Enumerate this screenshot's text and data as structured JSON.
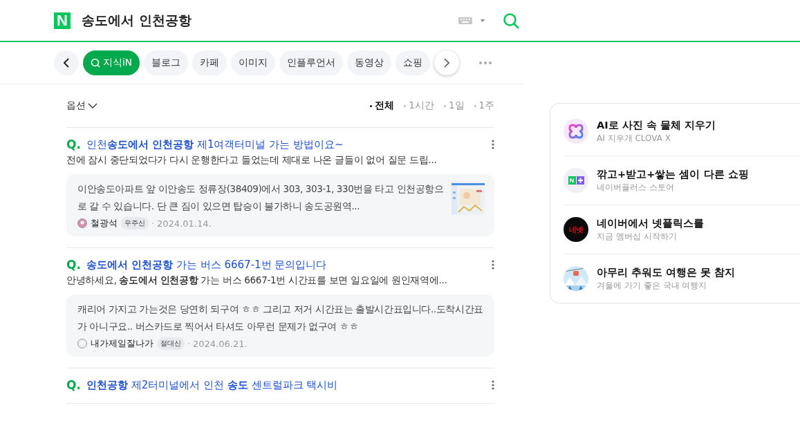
{
  "header": {
    "logo": "N",
    "query": "송도에서 인천공항"
  },
  "tabs": [
    {
      "label": "지식iN",
      "selected": true
    },
    {
      "label": "블로그",
      "selected": false
    },
    {
      "label": "카페",
      "selected": false
    },
    {
      "label": "이미지",
      "selected": false
    },
    {
      "label": "인플루언서",
      "selected": false
    },
    {
      "label": "동영상",
      "selected": false
    },
    {
      "label": "쇼핑",
      "selected": false
    }
  ],
  "options": {
    "label": "옵션",
    "periods": [
      {
        "label": "전체",
        "selected": true
      },
      {
        "label": "1시간",
        "selected": false
      },
      {
        "label": "1일",
        "selected": false
      },
      {
        "label": "1주",
        "selected": false
      }
    ]
  },
  "results": [
    {
      "mark": "Q.",
      "title": "인천**송도에서 인천공항** 제1여객터미널 가는 방법이요~",
      "snippet": "전에 잠시 중단되었다가 다시 운행한다고 들었는데 제대로 나온 글들이 없어 질문 드립...",
      "answer": {
        "text": "이안송도아파트 앞 이안송도 정류장(38409)에서 303, 303-1, 330번을 타고 인천공항으로 갈 수 있습니다. 단 큰 짐이 있으면 탑승이 불가하니 송도공원역...",
        "author": "철광석",
        "badge": "우주신",
        "date": "2024.01.14.",
        "thumbnail": true
      }
    },
    {
      "mark": "Q.",
      "title": "**송도에서 인천공항** 가는 버스 6667-1번 문의입니다",
      "snippet": "안녕하세요, **송도에서 인천공항** 가는 버스 6667-1번 시간표를 보면 일요일에 원인재역에...",
      "answer": {
        "text": "캐리어 가지고 가는것은 당연히 되구여 ㅎㅎ 그리고 저거 시간표는 출발시간표입니다..도착시간표가 아니구요.. 버스카드로 찍어서 타셔도 아무런 문제가 없구여 ㅎㅎ",
        "author": "내가제일잘나가",
        "badge": "절대신",
        "date": "2024.06.21.",
        "thumbnail": false
      }
    },
    {
      "mark": "Q.",
      "title": "**인천공항** 제2터미널에서 인천 **송도** 센트럴파크 택시비"
    }
  ],
  "ads": [
    {
      "kind": "clova",
      "title": "AI로 사진 속 물체 지우기",
      "subtitle": "AI 지우개 CLOVA X"
    },
    {
      "kind": "nplus",
      "title": "깎고+받고+쌓는 셈이 다른 쇼핑",
      "subtitle": "네이버플러스 스토어",
      "icon_text": "N"
    },
    {
      "kind": "netflix",
      "title": "네이버에서 넷플릭스를",
      "subtitle": "지금 멤버십 시작하기",
      "icon_text": "네넷"
    },
    {
      "kind": "travel",
      "title": "아무리 추워도 여행은 못 참지",
      "subtitle": "겨울에 가기 좋은 국내 여행지"
    }
  ]
}
